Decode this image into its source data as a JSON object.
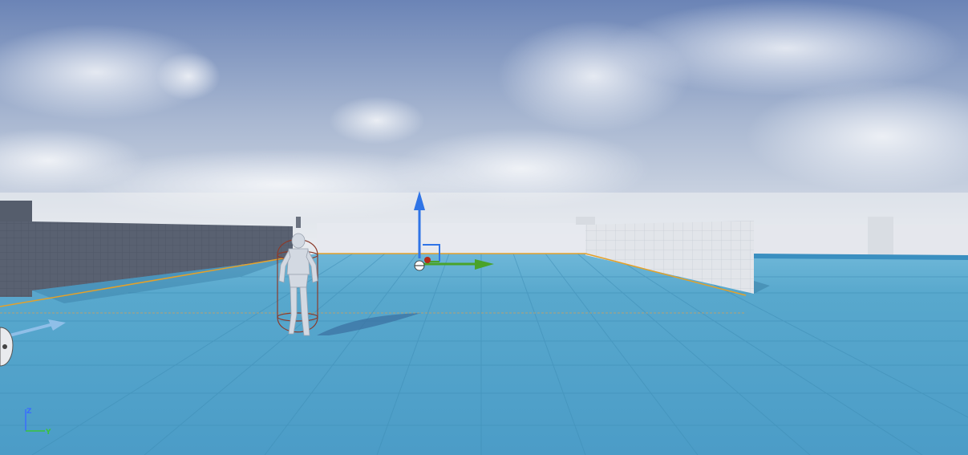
{
  "viewport": {
    "axis_labels": {
      "z": "Z",
      "y": "Y"
    },
    "colors": {
      "floor": "#56a7cc",
      "floor_grid": "#3f8eb6",
      "wall_dark": "#5a6272",
      "wall_light": "#dfe3e8",
      "selection_outline": "#e3a12a",
      "gizmo_z": "#2f74e6",
      "gizmo_y": "#4aa32a",
      "axis_z": "#3a6dff",
      "axis_y": "#39c43a",
      "capsule_wire": "#8b3b2c",
      "sky_top": "#6b84b6",
      "sky_horizon": "#e8ebef"
    },
    "icons": [
      "transform-gizmo-icon",
      "player-start-arrow-icon",
      "camera-actor-icon",
      "axis-indicator-icon"
    ]
  }
}
